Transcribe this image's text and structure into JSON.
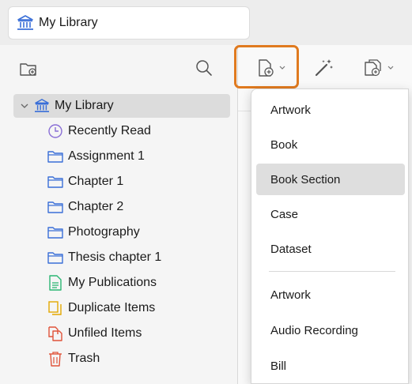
{
  "tab": {
    "label": "My Library",
    "icon": "library-icon"
  },
  "left_toolbar": {
    "new_collection_icon": "new-collection-icon",
    "search_icon": "search-icon"
  },
  "right_toolbar": {
    "new_item_icon": "new-item-icon",
    "add_by_identifier_icon": "magic-wand-icon",
    "new_note_icon": "new-note-icon"
  },
  "tree": {
    "root": {
      "label": "My Library",
      "expanded": true
    },
    "items": [
      {
        "label": "Recently Read",
        "icon": "clock-icon"
      },
      {
        "label": "Assignment 1",
        "icon": "folder-icon"
      },
      {
        "label": "Chapter 1",
        "icon": "folder-icon"
      },
      {
        "label": "Chapter 2",
        "icon": "folder-icon"
      },
      {
        "label": "Photography",
        "icon": "folder-icon"
      },
      {
        "label": "Thesis chapter 1",
        "icon": "folder-icon"
      },
      {
        "label": "My Publications",
        "icon": "document-icon"
      },
      {
        "label": "Duplicate Items",
        "icon": "duplicate-icon"
      },
      {
        "label": "Unfiled Items",
        "icon": "unfiled-icon"
      },
      {
        "label": "Trash",
        "icon": "trash-icon"
      }
    ]
  },
  "menu": {
    "recent": [
      "Artwork",
      "Book",
      "Book Section",
      "Case",
      "Dataset"
    ],
    "selected": "Book Section",
    "all": [
      "Artwork",
      "Audio Recording",
      "Bill"
    ]
  },
  "colors": {
    "accent": "#3a6fd8",
    "highlight": "#e07a1f",
    "clock": "#8a6fd6",
    "publications": "#2bb673",
    "duplicate": "#e3a800",
    "unfiled": "#e0533a",
    "trash": "#e0533a"
  }
}
